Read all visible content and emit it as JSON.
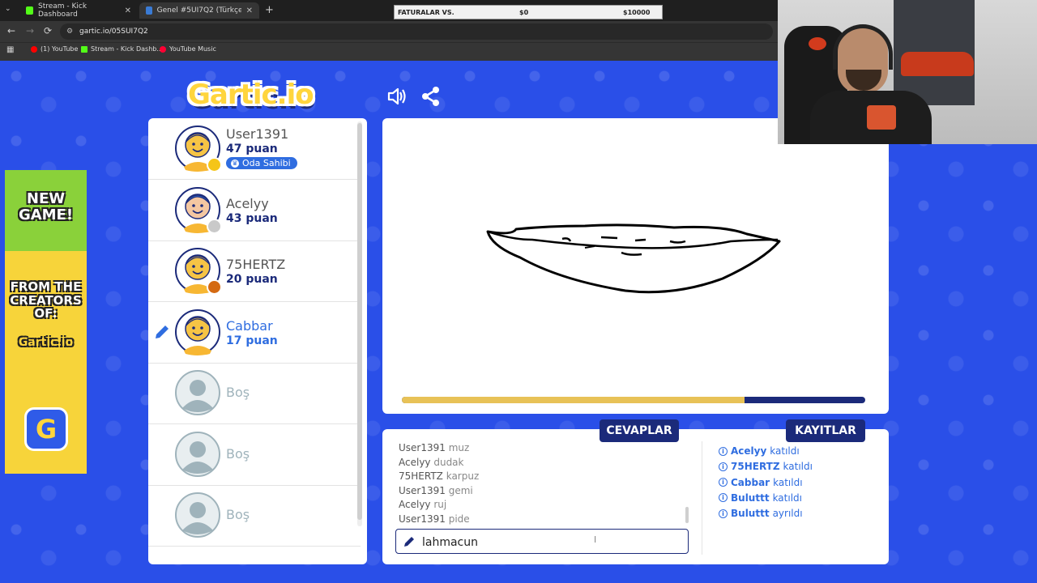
{
  "browser": {
    "tabs": [
      {
        "title": "Stream - Kick Dashboard",
        "favicon_color": "#53fc18"
      },
      {
        "title": "Genel #5UI7Q2 (Türkçe) - Gartic",
        "favicon_color": "#3a7bd5"
      }
    ],
    "new_tab": "+",
    "url": "gartic.io/05SUI7Q2",
    "bookmarks": [
      {
        "label": "(1) YouTube",
        "color": "#ff0000"
      },
      {
        "label": "Stream - Kick Dashb...",
        "color": "#53fc18"
      },
      {
        "label": "YouTube Music",
        "color": "#ff0033"
      }
    ]
  },
  "overlay": {
    "label": "FATURALAR VS.",
    "current": "$0",
    "goal": "$10000"
  },
  "logo": "Gartic.io",
  "players": [
    {
      "name": "User1391",
      "points": "47 puan",
      "badge": "Oda Sahibi",
      "status_color": "#f5c518",
      "skin": "#f6c445",
      "hair": "#f6c445",
      "highlight": false
    },
    {
      "name": "Acelyy",
      "points": "43 puan",
      "status_color": "#c9c9c9",
      "skin": "#f4c7a1",
      "hair": "#3a7bd5",
      "highlight": false
    },
    {
      "name": "75HERTZ",
      "points": "20 puan",
      "status_color": "#d46a12",
      "skin": "#f6c445",
      "hair": "#f6c445",
      "highlight": false
    },
    {
      "name": "Cabbar",
      "points": "17 puan",
      "status_color": "",
      "skin": "#f6c445",
      "hair": "#f6c445",
      "highlight": true
    },
    {
      "name": "Boş",
      "points": ""
    },
    {
      "name": "Boş",
      "points": ""
    },
    {
      "name": "Boş",
      "points": ""
    }
  ],
  "timer_progress": 0.74,
  "tabs": {
    "answers": "CEVAPLAR",
    "logs": "KAYITLAR"
  },
  "answers": [
    {
      "user": "User1391",
      "word": "muz"
    },
    {
      "user": "Acelyy",
      "word": "dudak"
    },
    {
      "user": "75HERTZ",
      "word": "karpuz"
    },
    {
      "user": "User1391",
      "word": "gemi"
    },
    {
      "user": "Acelyy",
      "word": "ruj"
    },
    {
      "user": "User1391",
      "word": "pide"
    }
  ],
  "logs": [
    {
      "user": "Acelyy",
      "action": "katıldı"
    },
    {
      "user": "75HERTZ",
      "action": "katıldı"
    },
    {
      "user": "Cabbar",
      "action": "katıldı"
    },
    {
      "user": "Buluttt",
      "action": "katıldı"
    },
    {
      "user": "Buluttt",
      "action": "ayrıldı"
    }
  ],
  "answer_input": {
    "value": "lahmacun"
  },
  "ad": {
    "line1": "NEW GAME!",
    "line2": "FROM THE CREATORS OF:",
    "brand": "Gartic.io"
  }
}
